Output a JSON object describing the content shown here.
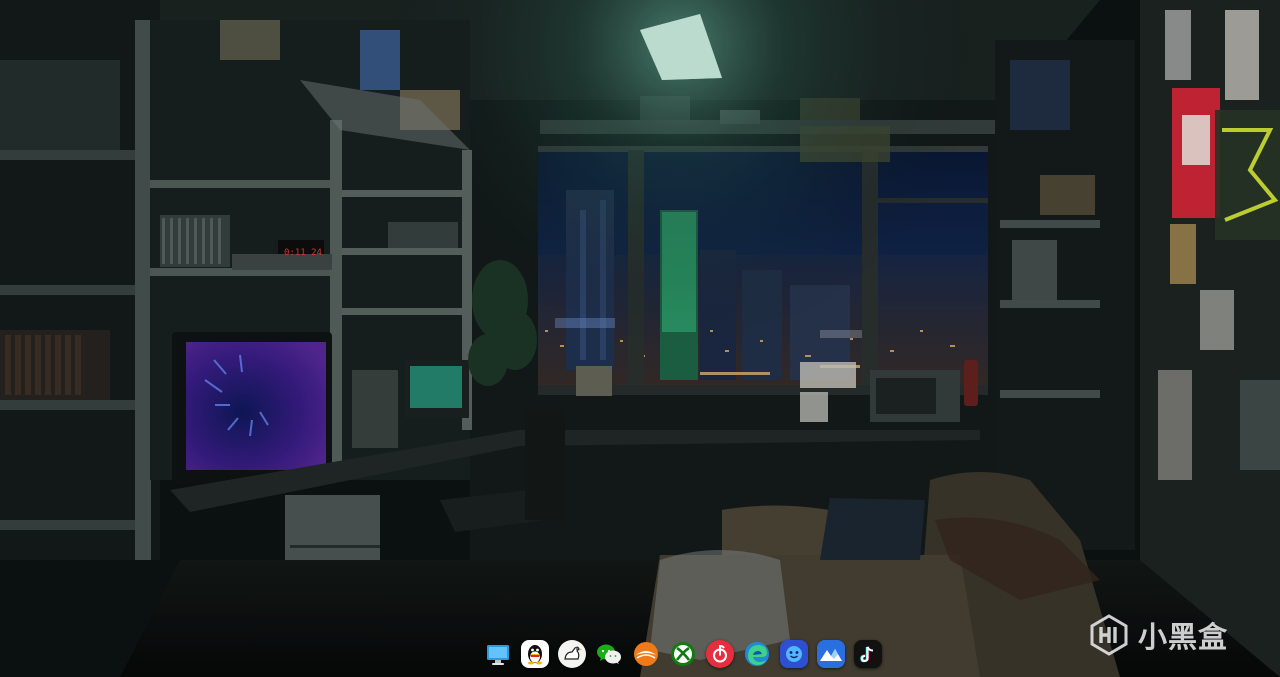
{
  "desktop": {
    "wallpaper": "night-city-room",
    "monitor_clock": "0:11 24"
  },
  "dock": {
    "items": [
      {
        "id": "computer",
        "icon": "monitor-icon",
        "color": "#2a9be0"
      },
      {
        "id": "qq",
        "icon": "penguin-icon",
        "color": "#ffffff"
      },
      {
        "id": "goose",
        "icon": "goose-icon",
        "color": "#ffffff"
      },
      {
        "id": "wechat",
        "icon": "chat-bubbles-icon",
        "color": "#1aad19"
      },
      {
        "id": "sunlogin",
        "icon": "sun-arc-icon",
        "color": "#f07a1a"
      },
      {
        "id": "xbox",
        "icon": "xbox-icon",
        "color": "#107c10"
      },
      {
        "id": "netease-music",
        "icon": "music-note-icon",
        "color": "#e62e3f"
      },
      {
        "id": "edge",
        "icon": "edge-icon",
        "color": "#1f8ad8"
      },
      {
        "id": "qq-game",
        "icon": "face-icon",
        "color": "#3c5bd8"
      },
      {
        "id": "mountains",
        "icon": "mountain-icon",
        "color": "#2a6fe0"
      },
      {
        "id": "tiktok",
        "icon": "tiktok-icon",
        "color": "#111111"
      }
    ]
  },
  "watermark": {
    "text": "小黑盒"
  }
}
